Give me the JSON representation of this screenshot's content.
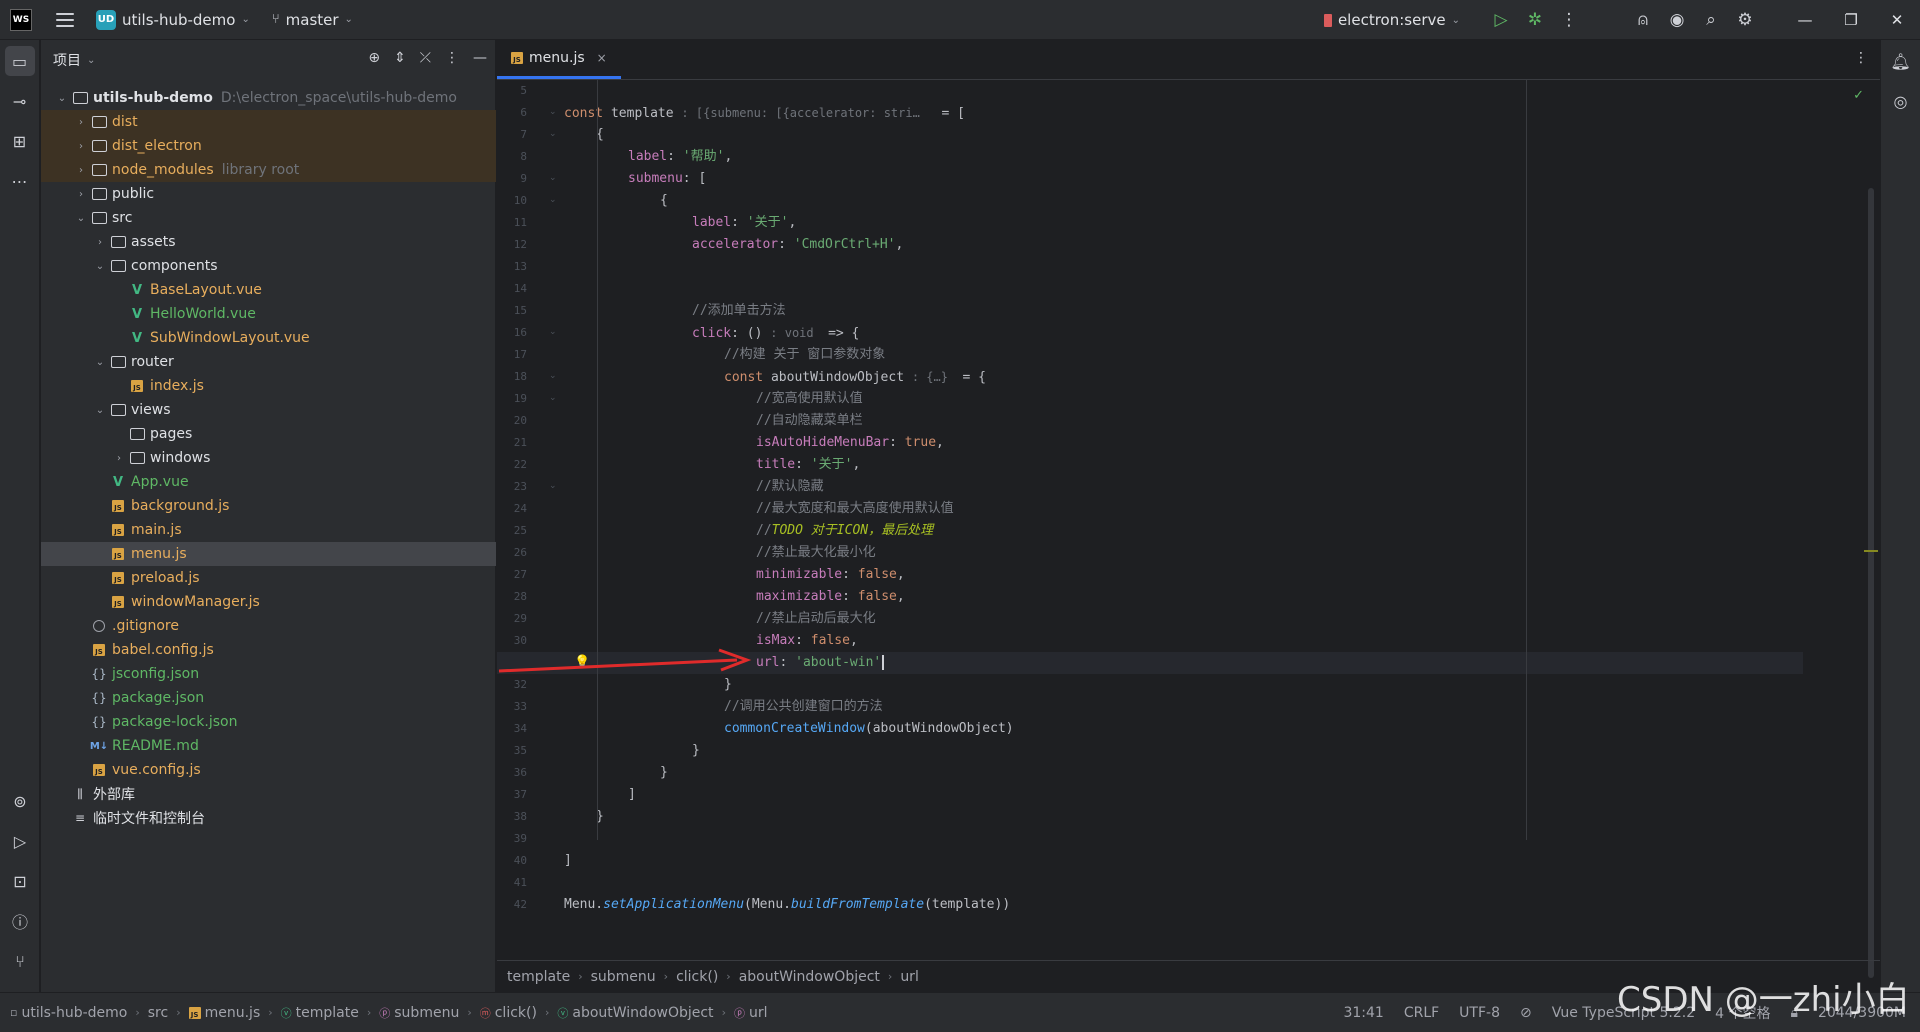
{
  "titlebar": {
    "logo": "WS",
    "project_badge": "UD",
    "project_name": "utils-hub-demo",
    "branch": "master",
    "run_config": "electron:serve",
    "icons": [
      "run-icon",
      "debug-icon",
      "more-icon",
      "add-user-icon",
      "ai-assistant-icon",
      "search-icon",
      "settings-icon"
    ],
    "window_controls": [
      "minimize",
      "restore",
      "close"
    ]
  },
  "project_panel": {
    "title": "项目",
    "root": {
      "name": "utils-hub-demo",
      "path": "D:\\electron_space\\utils-hub-demo"
    },
    "tree": [
      {
        "depth": 1,
        "twisty": "collapsed",
        "icon": "folder",
        "name": "dist",
        "color": "orange",
        "excluded": true
      },
      {
        "depth": 1,
        "twisty": "collapsed",
        "icon": "folder",
        "name": "dist_electron",
        "color": "orange",
        "excluded": true
      },
      {
        "depth": 1,
        "twisty": "collapsed",
        "icon": "folder",
        "name": "node_modules",
        "color": "orange",
        "hint": "library root",
        "excluded": true
      },
      {
        "depth": 1,
        "twisty": "collapsed",
        "icon": "folder",
        "name": "public",
        "color": "default"
      },
      {
        "depth": 1,
        "twisty": "expanded",
        "icon": "folder",
        "name": "src",
        "color": "default"
      },
      {
        "depth": 2,
        "twisty": "collapsed",
        "icon": "folder",
        "name": "assets",
        "color": "default"
      },
      {
        "depth": 2,
        "twisty": "expanded",
        "icon": "folder",
        "name": "components",
        "color": "default"
      },
      {
        "depth": 3,
        "twisty": "none",
        "icon": "vue",
        "name": "BaseLayout.vue",
        "color": "orange"
      },
      {
        "depth": 3,
        "twisty": "none",
        "icon": "vue",
        "name": "HelloWorld.vue",
        "color": "green"
      },
      {
        "depth": 3,
        "twisty": "none",
        "icon": "vue",
        "name": "SubWindowLayout.vue",
        "color": "orange"
      },
      {
        "depth": 2,
        "twisty": "expanded",
        "icon": "folder",
        "name": "router",
        "color": "default"
      },
      {
        "depth": 3,
        "twisty": "none",
        "icon": "js",
        "name": "index.js",
        "color": "orange"
      },
      {
        "depth": 2,
        "twisty": "expanded",
        "icon": "folder",
        "name": "views",
        "color": "default"
      },
      {
        "depth": 3,
        "twisty": "none",
        "icon": "folder",
        "name": "pages",
        "color": "default"
      },
      {
        "depth": 3,
        "twisty": "collapsed",
        "icon": "folder",
        "name": "windows",
        "color": "default"
      },
      {
        "depth": 2,
        "twisty": "none",
        "icon": "vue",
        "name": "App.vue",
        "color": "green"
      },
      {
        "depth": 2,
        "twisty": "none",
        "icon": "js",
        "name": "background.js",
        "color": "orange"
      },
      {
        "depth": 2,
        "twisty": "none",
        "icon": "js",
        "name": "main.js",
        "color": "orange"
      },
      {
        "depth": 2,
        "twisty": "none",
        "icon": "js",
        "name": "menu.js",
        "color": "orange",
        "selected": true
      },
      {
        "depth": 2,
        "twisty": "none",
        "icon": "js",
        "name": "preload.js",
        "color": "orange"
      },
      {
        "depth": 2,
        "twisty": "none",
        "icon": "js",
        "name": "windowManager.js",
        "color": "orange"
      },
      {
        "depth": 1,
        "twisty": "none",
        "icon": "gitignore",
        "name": ".gitignore",
        "color": "orange"
      },
      {
        "depth": 1,
        "twisty": "none",
        "icon": "js",
        "name": "babel.config.js",
        "color": "orange"
      },
      {
        "depth": 1,
        "twisty": "none",
        "icon": "json",
        "name": "jsconfig.json",
        "color": "green"
      },
      {
        "depth": 1,
        "twisty": "none",
        "icon": "json",
        "name": "package.json",
        "color": "green"
      },
      {
        "depth": 1,
        "twisty": "none",
        "icon": "json",
        "name": "package-lock.json",
        "color": "green"
      },
      {
        "depth": 1,
        "twisty": "none",
        "icon": "md",
        "name": "README.md",
        "color": "green"
      },
      {
        "depth": 1,
        "twisty": "none",
        "icon": "js",
        "name": "vue.config.js",
        "color": "orange"
      },
      {
        "depth": 0,
        "twisty": "none",
        "icon": "library",
        "name": "外部库",
        "color": "default"
      },
      {
        "depth": 0,
        "twisty": "none",
        "icon": "scratch",
        "name": "临时文件和控制台",
        "color": "default"
      }
    ]
  },
  "editor": {
    "tab": {
      "icon": "JS",
      "label": "menu.js",
      "close": "×"
    },
    "current_line": 31,
    "lines": [
      {
        "n": 5,
        "indent": 0,
        "tokens": []
      },
      {
        "n": 6,
        "indent": 0,
        "tokens": [
          [
            "kw",
            "const "
          ],
          [
            "plain",
            "template "
          ],
          [
            "hint",
            ": [{submenu: [{accelerator: stri…   "
          ],
          [
            "plain",
            "= ["
          ]
        ]
      },
      {
        "n": 7,
        "indent": 1,
        "tokens": [
          [
            "plain",
            "{"
          ]
        ]
      },
      {
        "n": 8,
        "indent": 2,
        "tokens": [
          [
            "prop",
            "label"
          ],
          [
            "plain",
            ": "
          ],
          [
            "str",
            "'帮助'"
          ],
          [
            "plain",
            ","
          ]
        ]
      },
      {
        "n": 9,
        "indent": 2,
        "tokens": [
          [
            "prop",
            "submenu"
          ],
          [
            "plain",
            ": ["
          ]
        ]
      },
      {
        "n": 10,
        "indent": 3,
        "tokens": [
          [
            "plain",
            "{"
          ]
        ]
      },
      {
        "n": 11,
        "indent": 4,
        "tokens": [
          [
            "prop",
            "label"
          ],
          [
            "plain",
            ": "
          ],
          [
            "str",
            "'关于'"
          ],
          [
            "plain",
            ","
          ]
        ]
      },
      {
        "n": 12,
        "indent": 4,
        "tokens": [
          [
            "prop",
            "accelerator"
          ],
          [
            "plain",
            ": "
          ],
          [
            "str",
            "'CmdOrCtrl+H'"
          ],
          [
            "plain",
            ","
          ]
        ]
      },
      {
        "n": 13,
        "indent": 0,
        "tokens": []
      },
      {
        "n": 14,
        "indent": 0,
        "tokens": []
      },
      {
        "n": 15,
        "indent": 4,
        "tokens": [
          [
            "cmt",
            "//添加单击方法"
          ]
        ]
      },
      {
        "n": 16,
        "indent": 4,
        "tokens": [
          [
            "prop",
            "click"
          ],
          [
            "plain",
            ": () "
          ],
          [
            "hint",
            ": void  "
          ],
          [
            "plain",
            "=> {"
          ]
        ]
      },
      {
        "n": 17,
        "indent": 5,
        "tokens": [
          [
            "cmt",
            "//构建 关于 窗口参数对象"
          ]
        ]
      },
      {
        "n": 18,
        "indent": 5,
        "tokens": [
          [
            "kw",
            "const "
          ],
          [
            "plain",
            "aboutWindowObject "
          ],
          [
            "hint",
            ": {…}  "
          ],
          [
            "plain",
            "= {"
          ]
        ]
      },
      {
        "n": 19,
        "indent": 6,
        "tokens": [
          [
            "cmt",
            "//宽高使用默认值"
          ]
        ]
      },
      {
        "n": 20,
        "indent": 6,
        "tokens": [
          [
            "cmt",
            "//自动隐藏菜单栏"
          ]
        ]
      },
      {
        "n": 21,
        "indent": 6,
        "tokens": [
          [
            "prop",
            "isAutoHideMenuBar"
          ],
          [
            "plain",
            ": "
          ],
          [
            "kw",
            "true"
          ],
          [
            "plain",
            ","
          ]
        ]
      },
      {
        "n": 22,
        "indent": 6,
        "tokens": [
          [
            "prop",
            "title"
          ],
          [
            "plain",
            ": "
          ],
          [
            "str",
            "'关于'"
          ],
          [
            "plain",
            ","
          ]
        ]
      },
      {
        "n": 23,
        "indent": 6,
        "tokens": [
          [
            "cmt",
            "//默认隐藏"
          ]
        ]
      },
      {
        "n": 24,
        "indent": 6,
        "tokens": [
          [
            "cmt",
            "//最大宽度和最大高度使用默认值"
          ]
        ]
      },
      {
        "n": 25,
        "indent": 6,
        "tokens": [
          [
            "cmt",
            "//"
          ],
          [
            "todo",
            "TODO 对于ICON，最后处理"
          ]
        ]
      },
      {
        "n": 26,
        "indent": 6,
        "tokens": [
          [
            "cmt",
            "//禁止最大化最小化"
          ]
        ]
      },
      {
        "n": 27,
        "indent": 6,
        "tokens": [
          [
            "prop",
            "minimizable"
          ],
          [
            "plain",
            ": "
          ],
          [
            "kw",
            "false"
          ],
          [
            "plain",
            ","
          ]
        ]
      },
      {
        "n": 28,
        "indent": 6,
        "tokens": [
          [
            "prop",
            "maximizable"
          ],
          [
            "plain",
            ": "
          ],
          [
            "kw",
            "false"
          ],
          [
            "plain",
            ","
          ]
        ]
      },
      {
        "n": 29,
        "indent": 6,
        "tokens": [
          [
            "cmt",
            "//禁止启动后最大化"
          ]
        ]
      },
      {
        "n": 30,
        "indent": 6,
        "tokens": [
          [
            "prop",
            "isMax"
          ],
          [
            "plain",
            ": "
          ],
          [
            "kw",
            "false"
          ],
          [
            "plain",
            ","
          ]
        ]
      },
      {
        "n": 31,
        "indent": 6,
        "tokens": [
          [
            "prop",
            "url"
          ],
          [
            "plain",
            ": "
          ],
          [
            "str",
            "'about-win'"
          ]
        ]
      },
      {
        "n": 32,
        "indent": 5,
        "tokens": [
          [
            "plain",
            "}"
          ]
        ]
      },
      {
        "n": 33,
        "indent": 5,
        "tokens": [
          [
            "cmt",
            "//调用公共创建窗口的方法"
          ]
        ]
      },
      {
        "n": 34,
        "indent": 5,
        "tokens": [
          [
            "fn",
            "commonCreateWindow"
          ],
          [
            "plain",
            "(aboutWindowObject)"
          ]
        ]
      },
      {
        "n": 35,
        "indent": 4,
        "tokens": [
          [
            "plain",
            "}"
          ]
        ]
      },
      {
        "n": 36,
        "indent": 3,
        "tokens": [
          [
            "plain",
            "}"
          ]
        ]
      },
      {
        "n": 37,
        "indent": 2,
        "tokens": [
          [
            "plain",
            "]"
          ]
        ]
      },
      {
        "n": 38,
        "indent": 1,
        "tokens": [
          [
            "plain",
            "}"
          ]
        ]
      },
      {
        "n": 39,
        "indent": 0,
        "tokens": []
      },
      {
        "n": 40,
        "indent": 0,
        "tokens": [
          [
            "plain",
            "]"
          ]
        ]
      },
      {
        "n": 41,
        "indent": 0,
        "tokens": []
      },
      {
        "n": 42,
        "indent": 0,
        "tokens": [
          [
            "plain",
            "Menu."
          ],
          [
            "fni",
            "setApplicationMenu"
          ],
          [
            "plain",
            "(Menu."
          ],
          [
            "fni",
            "buildFromTemplate"
          ],
          [
            "plain",
            "(template))"
          ]
        ]
      }
    ],
    "fold_lines": [
      6,
      7,
      9,
      10,
      16,
      18,
      19,
      23
    ],
    "breadcrumbs": [
      "template",
      "submenu",
      "click()",
      "aboutWindowObject",
      "url"
    ]
  },
  "statusbar": {
    "path": [
      {
        "icon": "module",
        "label": "utils-hub-demo"
      },
      {
        "icon": "",
        "label": "src"
      },
      {
        "icon": "js",
        "label": "menu.js"
      },
      {
        "icon": "vue",
        "label": "template"
      },
      {
        "icon": "prop",
        "label": "submenu"
      },
      {
        "icon": "fn",
        "label": "click()"
      },
      {
        "icon": "vue",
        "label": "aboutWindowObject"
      },
      {
        "icon": "prop",
        "label": "url"
      }
    ],
    "position": "31:41",
    "line_sep": "CRLF",
    "encoding": "UTF-8",
    "language": "Vue TypeScript 5.2.2",
    "indent": "4 个空格",
    "memory": "2044/3900M"
  },
  "watermark": "CSDN @一zhi小白"
}
